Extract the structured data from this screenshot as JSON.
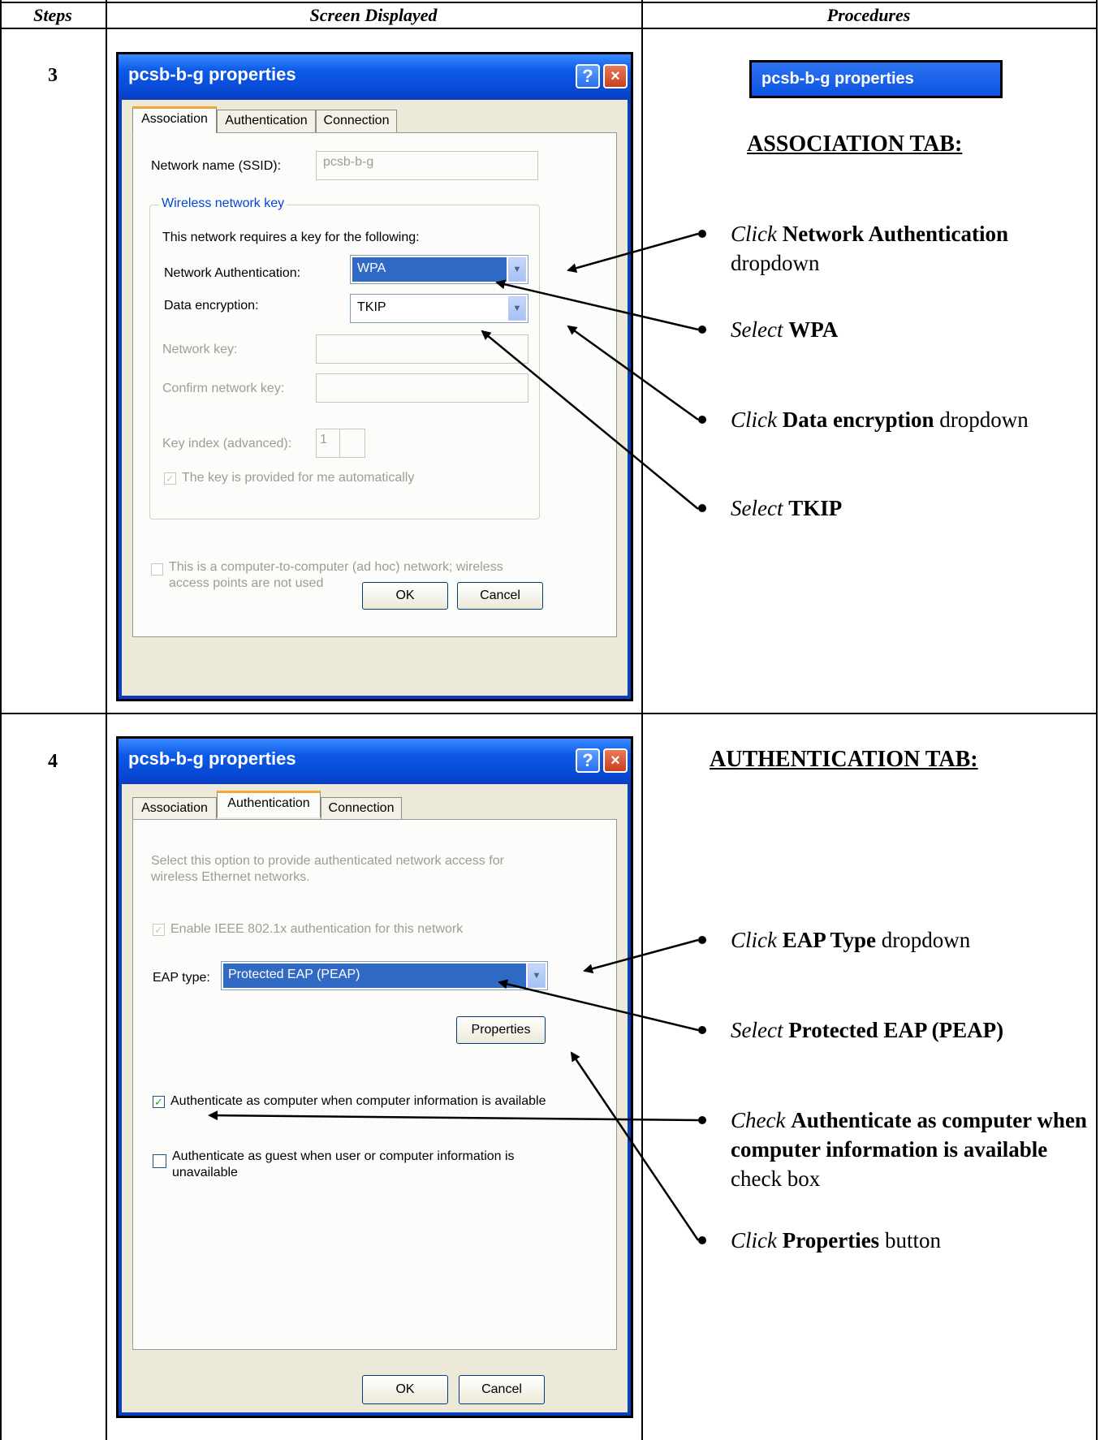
{
  "table": {
    "headers": [
      "Steps",
      "Screen Displayed",
      "Procedures"
    ]
  },
  "step3": {
    "number": "3",
    "dialog": {
      "title": "pcsb-b-g properties",
      "help": "?",
      "close": "×",
      "tabs": [
        "Association",
        "Authentication",
        "Connection"
      ],
      "network_name_label": "Network name (SSID):",
      "network_name_value": "pcsb-b-g",
      "group_title": "Wireless network key",
      "requires_text": "This network requires a key for the following:",
      "net_auth_label": "Network Authentication:",
      "net_auth_value": "WPA",
      "data_enc_label": "Data encryption:",
      "data_enc_value": "TKIP",
      "network_key_label": "Network key:",
      "confirm_key_label": "Confirm network key:",
      "key_index_label": "Key index (advanced):",
      "key_index_value": "1",
      "auto_key_text": "The key is provided for me automatically",
      "adhoc_text_1": "This is a computer-to-computer (ad hoc) network; wireless",
      "adhoc_text_2": "access points are not used",
      "ok": "OK",
      "cancel": "Cancel"
    },
    "chip_title": "pcsb-b-g properties",
    "heading": "ASSOCIATION TAB:",
    "procedures": [
      {
        "verb": "Click",
        "bold": "Network Authentication",
        "rest": " dropdown"
      },
      {
        "verb": "Select",
        "bold": "WPA",
        "rest": ""
      },
      {
        "verb": "Click",
        "bold": "Data encryption",
        "rest": " dropdown"
      },
      {
        "verb": "Select",
        "bold": "TKIP",
        "rest": ""
      }
    ]
  },
  "step4": {
    "number": "4",
    "dialog": {
      "title": "pcsb-b-g properties",
      "help": "?",
      "close": "×",
      "tabs": [
        "Association",
        "Authentication",
        "Connection"
      ],
      "desc_1": "Select this option to provide authenticated network access for",
      "desc_2": "wireless Ethernet networks.",
      "enable_8021x": "Enable IEEE 802.1x authentication for this network",
      "eap_label": "EAP type:",
      "eap_value": "Protected EAP (PEAP)",
      "properties": "Properties",
      "auth_computer": "Authenticate as computer when computer information is available",
      "auth_guest_1": "Authenticate as guest when user or computer information is",
      "auth_guest_2": "unavailable",
      "ok": "OK",
      "cancel": "Cancel"
    },
    "heading": "AUTHENTICATION TAB:",
    "procedures": [
      {
        "verb": "Click",
        "bold": "EAP Type",
        "rest": " dropdown"
      },
      {
        "verb": "Select",
        "bold": "Protected EAP (PEAP)",
        "rest": ""
      },
      {
        "verb": "Check",
        "bold": " Authenticate as computer when computer information is available",
        "rest": "  check box"
      },
      {
        "verb": "Click",
        "bold": "Properties",
        "rest": " button"
      }
    ]
  },
  "colors": {
    "xp_title_blue": "#0d5ae8",
    "xp_face": "#ECE9D8",
    "selection_blue": "#316ac5",
    "active_tab_orange": "#f5a63a"
  }
}
